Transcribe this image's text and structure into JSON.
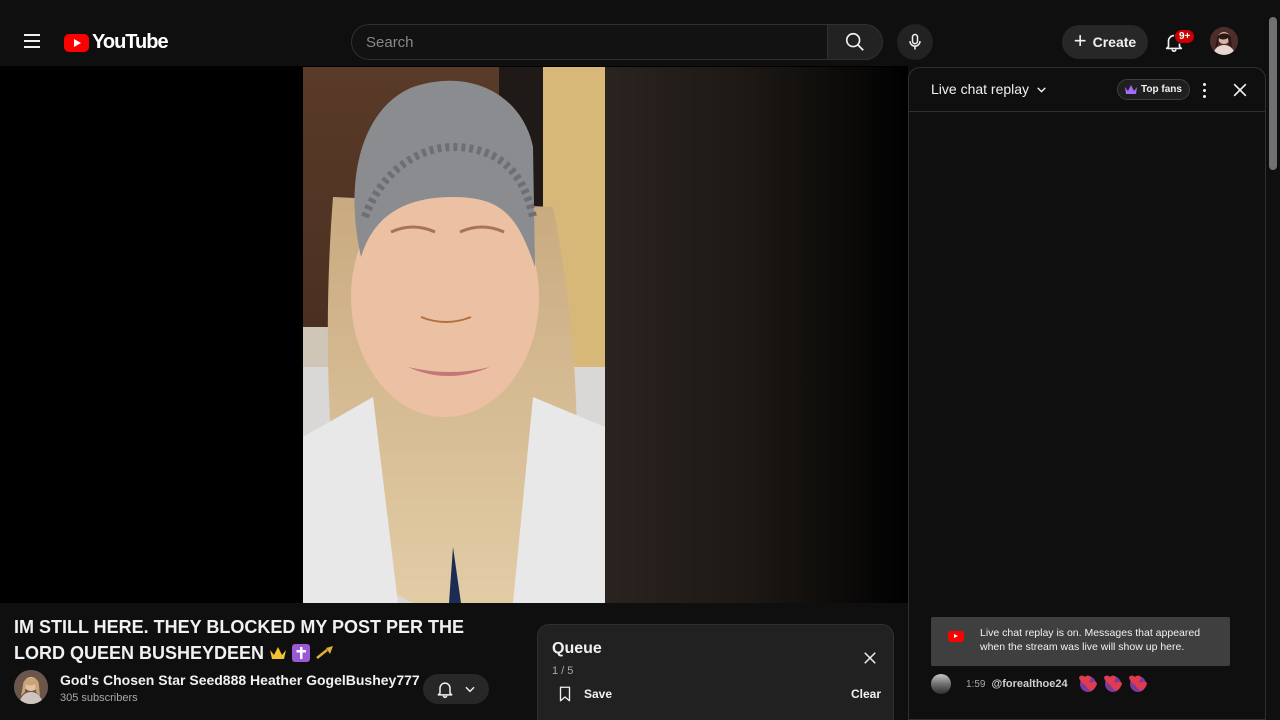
{
  "masthead": {
    "logo_text": "YouTube",
    "search_placeholder": "Search",
    "create_label": "Create",
    "notification_count": "9+"
  },
  "video": {
    "title_text": "IM STILL HERE. THEY BLOCKED MY POST PER THE LORD QUEEN BUSHEYDEEN",
    "title_emojis": [
      "crown",
      "latin-cross",
      "trumpet"
    ]
  },
  "channel": {
    "name": "God's Chosen Star Seed888 Heather GogelBushey777",
    "subscribers": "305 subscribers"
  },
  "queue": {
    "title": "Queue",
    "count": "1 / 5",
    "save_label": "Save",
    "clear_label": "Clear"
  },
  "chat": {
    "mode_label": "Live chat replay",
    "top_fans_label": "Top fans",
    "notice": "Live chat replay is on. Messages that appeared when the stream was live will show up here.",
    "messages": [
      {
        "time": "1:59",
        "author": "@forealthoe24",
        "content": [
          "heart-face",
          "heart-face",
          "heart-face"
        ]
      }
    ]
  },
  "colors": {
    "accent": "#ff0000",
    "background": "#0f0f0f",
    "surface": "#272727",
    "badge": "#cc0000",
    "crown": "#a56bff"
  }
}
